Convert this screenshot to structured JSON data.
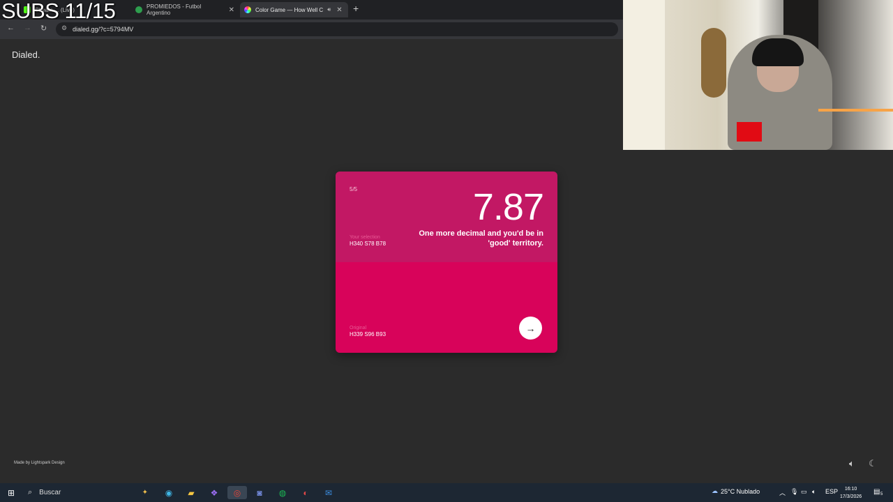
{
  "overlay": {
    "subs_counter": "SUBS 11/15"
  },
  "browser": {
    "tabs": [
      {
        "title": "Stream ... (Live)"
      },
      {
        "title": "PROMIEDOS - Futbol Argentino"
      },
      {
        "title": "Color Game — How Well C"
      }
    ],
    "new_tab": "+",
    "url": "dialed.gg/?c=5794MV"
  },
  "page": {
    "brand": "Dialed.",
    "footer_credit": "Made by Lightspark Design"
  },
  "result_card": {
    "progress": "5/5",
    "score": "7.87",
    "message": "One more decimal and you'd be in 'good' territory.",
    "selection_label": "Your selection",
    "selection_value": "H340 S78 B78",
    "original_label": "Original",
    "original_value": "H339 S96 B93",
    "next_icon": "arrow-right-icon",
    "colors": {
      "selection": "#c21864",
      "original": "#d8035a"
    }
  },
  "taskbar": {
    "search_placeholder": "Buscar",
    "weather": "25°C  Nublado",
    "language": "ESP",
    "time": "16:10",
    "date": "17/3/2026",
    "notification_count": "5"
  }
}
